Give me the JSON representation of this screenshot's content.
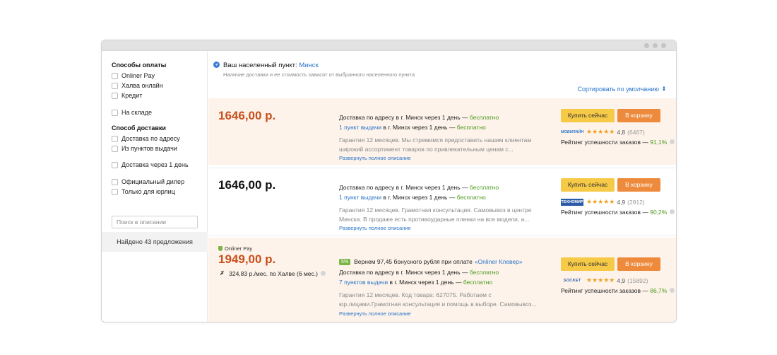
{
  "sidebar": {
    "payment_title": "Способы оплаты",
    "payment_options": [
      "Onliner Pay",
      "Халва онлайн",
      "Кредит"
    ],
    "stock_label": "На складе",
    "delivery_title": "Способ доставки",
    "delivery_options": [
      "Доставка по адресу",
      "Из пунктов выдачи"
    ],
    "delivery_1day": "Доставка через 1 день",
    "extra_options": [
      "Официальный дилер",
      "Только для юрлиц"
    ],
    "search_placeholder": "Поиск в описании",
    "found_text": "Найдено 43 предложения"
  },
  "location": {
    "label": "Ваш населенный пункт:",
    "city": "Минск",
    "note": "Наличие доставки и ее стоимость зависят от выбранного населенного пункта"
  },
  "sort": {
    "label": "Сортировать по умолчанию"
  },
  "buttons": {
    "buy": "Купить сейчас",
    "cart": "В корзину"
  },
  "offers": [
    {
      "price": "1646,00 р.",
      "delivery_text": "Доставка по адресу в г. Минск через 1 день — ",
      "delivery_free": "бесплатно",
      "pickup_link": "1 пункт выдачи",
      "pickup_text": " в г. Минск через 1 день — ",
      "pickup_free": "бесплатно",
      "description": "Гарантия 12 месяцев. Мы стремимся предоставить нашим клиентам широкий ассортимент товаров по привлекательным ценам с...",
      "expand": "Развернуть полное описание",
      "shop_logo": "МОБИЛАЙН",
      "stars": "★★★★★",
      "rating": "4,8",
      "reviews": "(6467)",
      "success_label": "Рейтинг успешности заказов — ",
      "success_pct": "91,1%"
    },
    {
      "price": "1646,00 р.",
      "delivery_text": "Доставка по адресу в г. Минск через 1 день — ",
      "delivery_free": "бесплатно",
      "pickup_link": "1 пункт выдачи",
      "pickup_text": " в г. Минск через 1 день — ",
      "pickup_free": "бесплатно",
      "description": "Гарантия 12 месяцев. Грамотная консультация. Самовывоз в центре Минска. В продаже есть противоударные пленки на все модели, а...",
      "expand": "Развернуть полное описание",
      "shop_logo": "ТЕХНОМИР",
      "stars": "★★★★★",
      "rating": "4,9",
      "reviews": "(2912)",
      "success_label": "Рейтинг успешности заказов — ",
      "success_pct": "90,2%"
    },
    {
      "pay_badge": "Onliner Pay",
      "price": "1949,00 р.",
      "halva": "324,83 р./мес. по Халве (6 мес.)",
      "bonus_pct": "5%",
      "bonus_text": "Вернем 97,45 бонусного рубля при оплате",
      "bonus_link": "«Onliner Клевер»",
      "delivery_text": "Доставка по адресу в г. Минск через 1 день — ",
      "delivery_free": "бесплатно",
      "pickup_link": "7 пунктов выдачи",
      "pickup_text": " в г. Минск через 1 день — ",
      "pickup_free": "бесплатно",
      "description": "Гарантия 12 месяцев. Код товара: 627075. Работаем с юр.лицами.Грамотная консультация и помощь в выборе. Самовывоз...",
      "expand": "Развернуть полное описание",
      "shop_logo": "SOCKET",
      "stars": "★★★★★",
      "rating": "4,9",
      "reviews": "(15892)",
      "success_label": "Рейтинг успешности заказов — ",
      "success_pct": "86,7%"
    }
  ]
}
